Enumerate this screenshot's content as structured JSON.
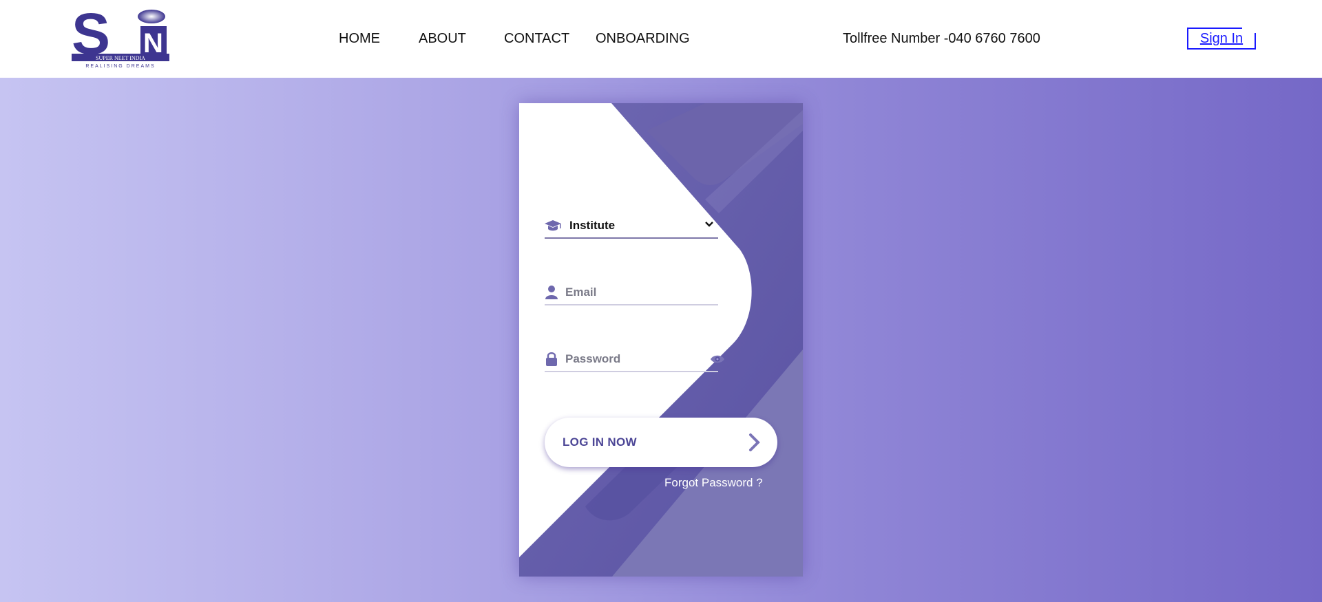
{
  "header": {
    "logo": {
      "letters": "SN",
      "name": "SUPER NEET INDIA",
      "tagline": "REALISING DREAMS"
    },
    "nav": [
      {
        "label": "HOME"
      },
      {
        "label": "ABOUT"
      },
      {
        "label": "CONTACT"
      },
      {
        "label": "ONBOARDING"
      }
    ],
    "tollfree": "Tollfree Number -040 6760 7600",
    "signin": "Sign In"
  },
  "login": {
    "role": {
      "value": "Institute",
      "icon": "graduation-cap-icon"
    },
    "email": {
      "placeholder": "Email",
      "icon": "user-icon"
    },
    "password": {
      "placeholder": "Password",
      "icon": "lock-icon",
      "toggle_icon": "eye-icon"
    },
    "submit": "LOG IN NOW",
    "forgot": "Forgot Password ?"
  },
  "colors": {
    "brand": "#3d3590",
    "accent": "#5c55a8",
    "bg_left": "#c6c4f2",
    "bg_right": "#7568c7",
    "link": "#1a1aff"
  }
}
